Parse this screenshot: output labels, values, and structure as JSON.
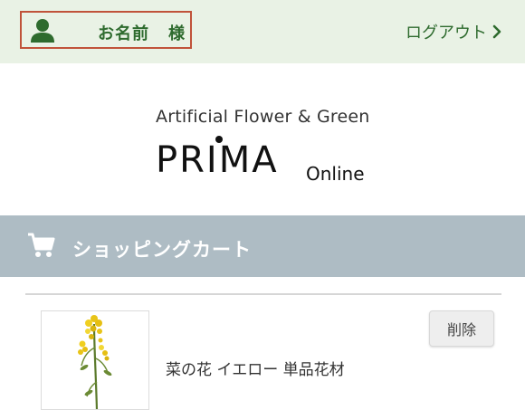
{
  "header": {
    "user_name": "お名前",
    "user_suffix": "様",
    "logout_label": "ログアウト",
    "accent_color": "#2e6b2e",
    "background_color": "#e9f2e5",
    "user_icon": "person-icon",
    "logout_icon": "chevron-right-icon"
  },
  "logo": {
    "tagline": "Artificial Flower & Green",
    "brand": "PRIMA",
    "suffix": "Online"
  },
  "section": {
    "title": "ショッピングカート",
    "icon": "shopping-cart-icon",
    "background_color": "#aebcc4"
  },
  "cart": {
    "items": [
      {
        "name": "菜の花 イエロー 単品花材",
        "delete_label": "削除",
        "image": "yellow-flower-image"
      }
    ]
  }
}
